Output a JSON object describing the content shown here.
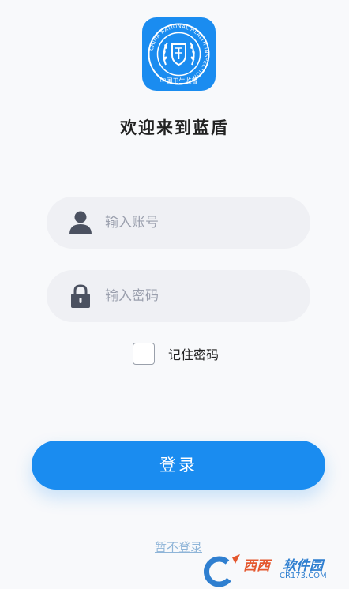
{
  "logo": {
    "icon": "national-health-inspection-emblem",
    "ring_text": "CHINA NATIONAL HEALTH INSPECTION",
    "bottom_text": "中国卫生监督"
  },
  "welcome_title": "欢迎来到蓝盾",
  "account": {
    "icon": "user-icon",
    "placeholder": "输入账号"
  },
  "password": {
    "icon": "lock-icon",
    "placeholder": "输入密码"
  },
  "remember": {
    "label": "记住密码",
    "checked": false
  },
  "login_label": "登录",
  "skip_label": "暂不登录",
  "watermark": {
    "text_red": "西西",
    "text_blue": "软件园",
    "url": "CR173.COM"
  },
  "colors": {
    "primary": "#1a8cf0",
    "field_bg": "#eff0f4",
    "placeholder": "#9a9fad",
    "link": "#8fb5d8",
    "background": "#f8f9fb"
  }
}
